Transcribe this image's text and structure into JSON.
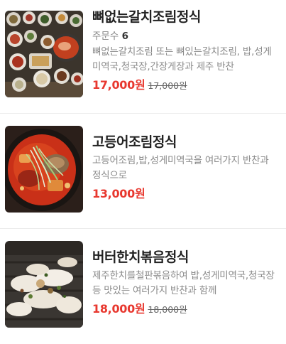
{
  "items": [
    {
      "name": "뼈없는갈치조림정식",
      "order_count_label": "주문수",
      "order_count": "6",
      "description": "뼈없는갈치조림 또는 뼈있는갈치조림, 밥,성게미역국,청국장,간장게장과 제주 반찬",
      "price": "17,000원",
      "original_price": "17,000원",
      "image_icon": "galchi-jorim-set-photo"
    },
    {
      "name": "고등어조림정식",
      "description": "고등어조림,밥,성게미역국을 여러가지 반찬과 정식으로",
      "price": "13,000원",
      "image_icon": "mackerel-braise-photo"
    },
    {
      "name": "버터한치볶음정식",
      "description": "제주한치를철판볶음하여 밥,성게미역국,청국장 등 맛있는 여러가지 반찬과 함께",
      "price": "18,000원",
      "original_price": "18,000원",
      "image_icon": "squid-stirfry-photo"
    }
  ]
}
